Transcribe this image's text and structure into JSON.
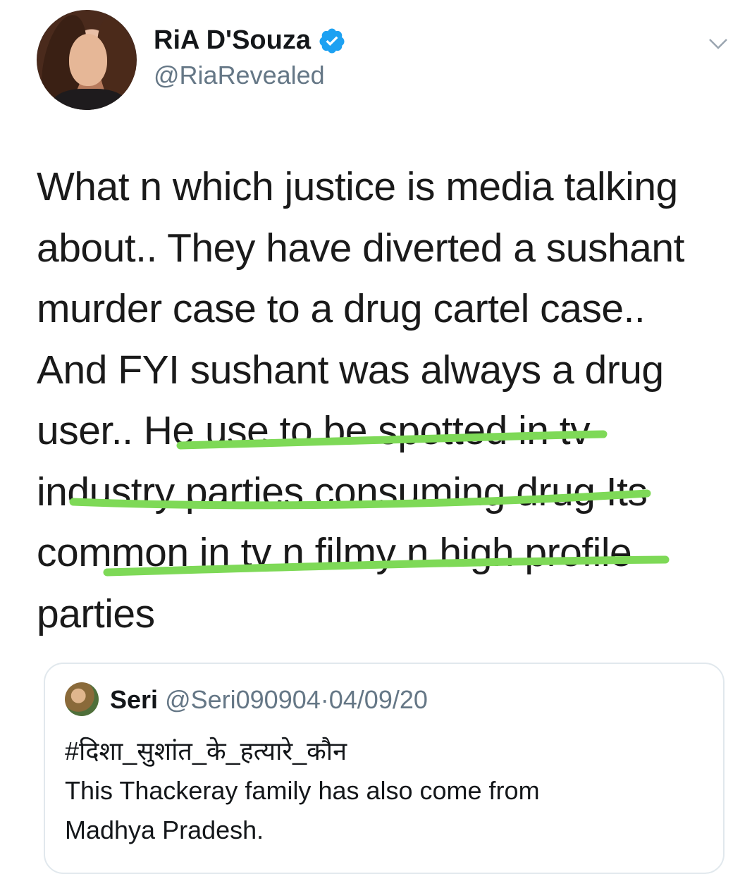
{
  "tweet": {
    "author_name": "RiA D'Souza",
    "author_handle": "@RiaRevealed",
    "lines": [
      "What n which justice is media talking",
      "about.. They have diverted a sushant",
      "murder case to a drug cartel case..",
      "And FYI sushant was always a drug",
      "user.. He use to be spotted in tv",
      "industry parties consuming drug  Its",
      "common in tv n filmy n high profile",
      "parties"
    ]
  },
  "quoted_tweet": {
    "author_name": "Seri",
    "author_handle": "@Seri090904",
    "separator": "·",
    "date": "04/09/20",
    "hashtag": "#दिशा_सुशांत_के_हत्यारे_कौन",
    "line1": "This Thackeray family has also come from",
    "line2": "Madhya Pradesh."
  },
  "colors": {
    "verified": "#1da1f2",
    "highlight": "#7ed957",
    "muted_text": "#657786",
    "card_border": "#e1e8ed"
  },
  "icons": [
    "verified-badge-icon",
    "chevron-down-icon"
  ]
}
